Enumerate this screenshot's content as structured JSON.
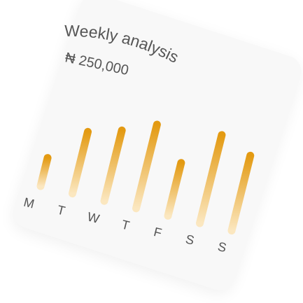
{
  "card": {
    "title": "Weekly analysis",
    "amount": "₦ 250,000"
  },
  "colors": {
    "bar_top": "#e39a12",
    "bar_bottom": "#fbe7c0",
    "text": "#555555",
    "card": "#f8f8f8"
  },
  "chart_data": {
    "type": "bar",
    "title": "Weekly analysis",
    "subtitle": "₦ 250,000",
    "categories": [
      "M",
      "T",
      "W",
      "T",
      "F",
      "S",
      "S"
    ],
    "values": [
      32,
      70,
      80,
      95,
      60,
      100,
      85
    ],
    "ylim": [
      0,
      100
    ],
    "grid": false,
    "legend": "none"
  }
}
